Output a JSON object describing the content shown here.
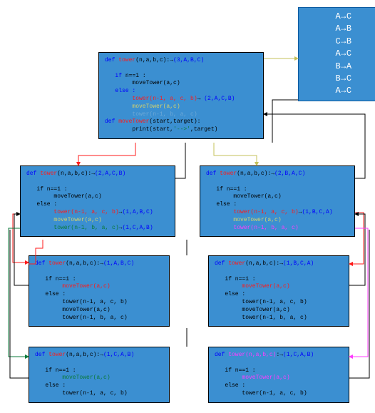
{
  "colors": {
    "boxFill": "#3b8fd1",
    "boxStroke": "#000",
    "red": "#ff1a1a",
    "blue": "#0000ff",
    "green": "#0a7a3a",
    "yellow": "#d6d26a",
    "magenta": "#ff3cff",
    "faded": "#6da8d6",
    "outFill": "#3b8fd1",
    "outText": "#ffffff"
  },
  "output": {
    "lines": [
      "A→C",
      "A→B",
      "C→B",
      "A→C",
      "B→A",
      "B→C",
      "A→C"
    ]
  },
  "top": {
    "sig": "(3,A,B,C)",
    "l1": "def ",
    "l1b": "tower",
    "l1c": "(n,a,b,c):→",
    "if": "   if ",
    "ifC": "n==1 :",
    "mv1": "        moveTower(a,c)",
    "else": "   else :",
    "r1": "        ",
    "r1b": "tower(n-1, a, c, b)",
    "r1c": "→ ",
    "r1sig": "(2,A,C,B)",
    "r2": "        ",
    "r2b": "moveTower(a,c)",
    "r3": "        ",
    "r3b": "tower(n-1, b, a, c)",
    "mdef": "def ",
    "mdefb": "moveTower",
    "mdefc": "(start,target):",
    "mprint": "        print(start,",
    "mprint2": "'-->'",
    "mprint3": ",target)"
  },
  "leftA": {
    "sig": "(2,A,C,B)",
    "r1sig": "(1,A,B,C)",
    "r3sig": "(1,C,A,B)",
    "def": "def ",
    "defb": "tower",
    "defc": "(n,a,b,c):→",
    "if": "   if n==1 :",
    "mv": "        moveTower(a,c)",
    "else": "   else :",
    "r1": "        ",
    "r1b": "tower(n-1, a, c, b)",
    "r1c": "→",
    "r2": "        ",
    "r2b": "moveTower(a,c)",
    "r3": "        ",
    "r3b": "tower(n-1, b, a, c)",
    "r3c": "→"
  },
  "leftB": {
    "sig": "(1,A,B,C)",
    "def": "def ",
    "defb": "tower",
    "defc": "(n,a,b,c):→",
    "if": "   if n==1 :",
    "mv": "        ",
    "mvb": "moveTower(a,c)",
    "else": "   else :",
    "r1": "        tower(n-1, a, c, b)",
    "r2": "        moveTower(a,c)",
    "r3": "        tower(n-1, b, a, c)"
  },
  "leftC": {
    "sig": "(1,C,A,B)",
    "def": "def ",
    "defb": "tower",
    "defc": "(n,a,b,c):→",
    "if": "   if n==1 :",
    "mv": "        ",
    "mvb": "moveTower(a,c)",
    "else": "   else :",
    "r1": "        tower(n-1, a, c, b)"
  },
  "rightA": {
    "sig": "(2,B,A,C)",
    "r1sig": "(1,B,C,A)",
    "def": "def ",
    "defb": "tower",
    "defc": "(n,a,b,c):→",
    "if": "   if n==1 :",
    "mv": "        moveTower(a,c)",
    "else": "   else :",
    "r1": "        ",
    "r1b": "tower(n-1, a, c, b)",
    "r1c": "→",
    "r2": "        ",
    "r2b": "moveTower(a,c)",
    "r3": "        ",
    "r3b": "tower(n-1, b, a, c)"
  },
  "rightB": {
    "sig": "(1,B,C,A)",
    "def": "def ",
    "defb": "tower",
    "defc": "(n,a,b,c):→",
    "if": "   if n==1 :",
    "mv": "        ",
    "mvb": "moveTower(a,c)",
    "else": "   else :",
    "r1": "        tower(n-1, a, c, b)",
    "r2": "        moveTower(a,c)",
    "r3": "        tower(n-1, b, a, c)"
  },
  "rightC": {
    "sig": "(1,C,A,B)",
    "def": "def ",
    "defb": "tower",
    "defc": "(n,a,b,c)",
    "defd": ":→",
    "if": "   if n==1 :",
    "mv": "        ",
    "mvb": "moveTower(a,c)",
    "else": "   else :",
    "r1": "        tower(n-1, a, c, b)"
  }
}
